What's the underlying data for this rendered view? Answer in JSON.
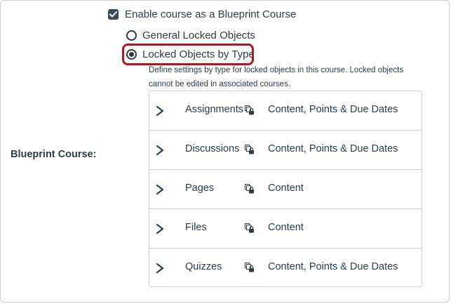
{
  "section_label": "Blueprint Course:",
  "enable_checkbox": {
    "label": "Enable course as a Blueprint Course",
    "checked": true
  },
  "lock_mode": {
    "options": [
      {
        "label": "General Locked Objects",
        "selected": false
      },
      {
        "label": "Locked Objects by Type",
        "selected": true
      }
    ]
  },
  "help_text": "Define settings by type for locked objects in this course. Locked objects cannot be edited in associated courses.",
  "object_types": [
    {
      "name": "Assignments",
      "locked": "Content, Points & Due Dates"
    },
    {
      "name": "Discussions",
      "locked": "Content, Points & Due Dates"
    },
    {
      "name": "Pages",
      "locked": "Content"
    },
    {
      "name": "Files",
      "locked": "Content"
    },
    {
      "name": "Quizzes",
      "locked": "Content, Points & Due Dates"
    }
  ],
  "colors": {
    "text": "#2d3b45",
    "highlight": "#a31c22",
    "border": "#c7cdd1"
  }
}
